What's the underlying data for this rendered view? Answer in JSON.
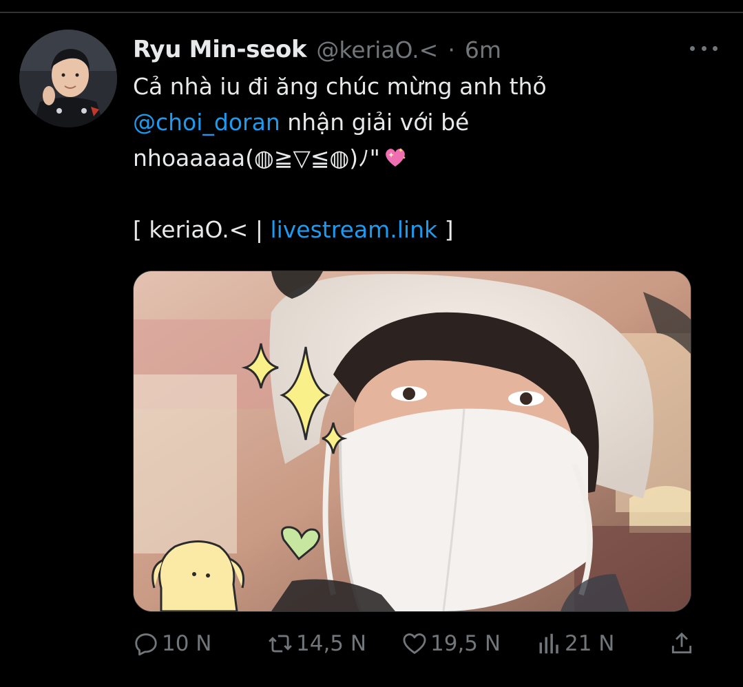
{
  "tweet": {
    "display_name": "Ryu Min-seok",
    "handle": "@keriaO.<",
    "separator": "·",
    "time": "6m",
    "text_line1": "Cả nhà iu đi ăng chúc mừng anh thỏ",
    "mention": "@choi_doran",
    "text_line2_rest": " nhận giải với bé",
    "text_line3": "nhoaaaaa(◍≧▽≦◍)ﾉ\"",
    "text_line4_open": "[ keriaO.< | ",
    "link": "livestream.link",
    "text_line4_close": " ]"
  },
  "actions": {
    "reply_count": "10 N",
    "retweet_count": "14,5 N",
    "like_count": "19,5 N",
    "views_count": "21 N"
  },
  "icons": {
    "more": "more-icon",
    "reply": "reply-icon",
    "retweet": "retweet-icon",
    "like": "like-icon",
    "views": "views-icon",
    "share": "share-icon",
    "emoji": "sparkling-heart-icon"
  },
  "colors": {
    "background": "#000000",
    "text": "#e7e9ea",
    "muted": "#71767b",
    "accent": "#1d9bf0"
  }
}
